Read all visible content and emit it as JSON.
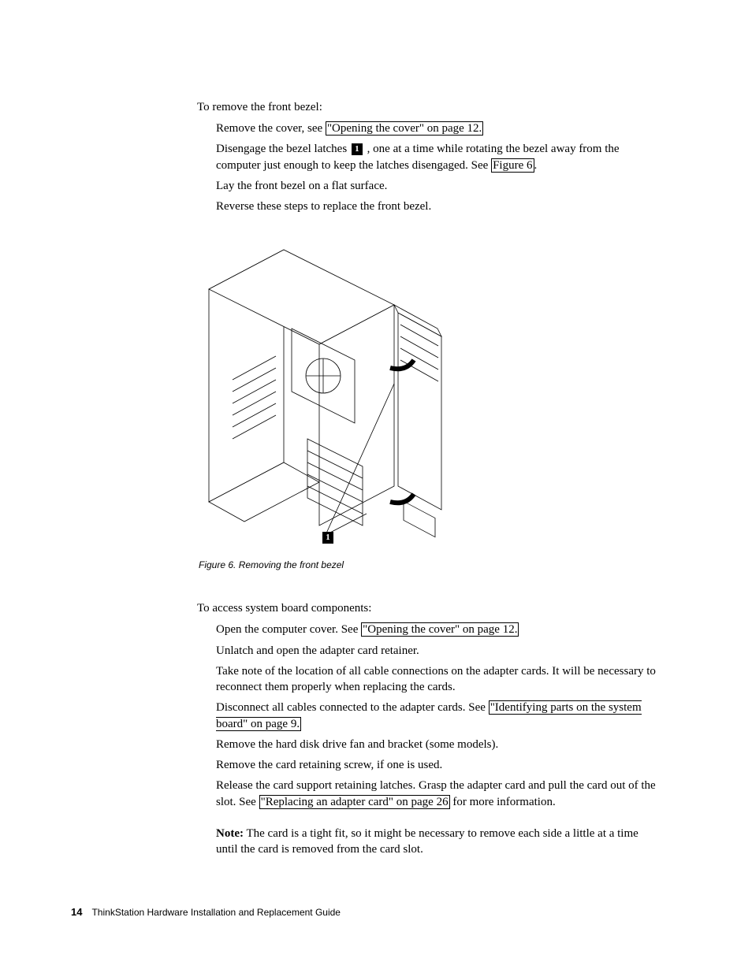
{
  "section1": {
    "intro": "To remove the front bezel:",
    "steps": [
      {
        "before": "Remove the cover, see ",
        "link": "\"Opening the cover\" on page 12.",
        "after": ""
      },
      {
        "before": "Disengage the bezel latches ",
        "callout": "1",
        "mid": " , one at a time while rotating the bezel away from the computer just enough to keep the latches disengaged. See ",
        "link": "Figure 6",
        "after": "."
      },
      {
        "before": "Lay the front bezel on a flat surface.",
        "link": "",
        "after": ""
      },
      {
        "before": "Reverse these steps to replace the front bezel.",
        "link": "",
        "after": ""
      }
    ]
  },
  "figure": {
    "callout": "1",
    "caption": "Figure 6. Removing the front bezel"
  },
  "section2": {
    "intro": "To access system board components:",
    "steps": [
      {
        "before": "Open the computer cover. See ",
        "link": "\"Opening the cover\" on page 12.",
        "after": ""
      },
      {
        "before": "Unlatch and open the adapter card retainer.",
        "link": "",
        "after": ""
      },
      {
        "before": "Take note of the location of all cable connections on the adapter cards. It will be necessary to reconnect them properly when replacing the cards.",
        "link": "",
        "after": ""
      },
      {
        "before": "Disconnect all cables connected to the adapter cards. See ",
        "link": "\"Identifying parts on the system board\" on page 9.",
        "after": ""
      },
      {
        "before": "Remove the hard disk drive fan and bracket (some models).",
        "link": "",
        "after": ""
      },
      {
        "before": "Remove the card retaining screw, if one is used.",
        "link": "",
        "after": ""
      },
      {
        "before": "Release the card support retaining latches. Grasp the adapter card and pull the card out of the slot. See ",
        "link": "\"Replacing an adapter card\" on page 26",
        "after": " for more information."
      }
    ],
    "note_label": "Note:",
    "note_text": " The card is a tight fit, so it might be necessary to remove each side a little at a time until the card is removed from the card slot."
  },
  "footer": {
    "page": "14",
    "title": "ThinkStation Hardware Installation and Replacement Guide"
  }
}
